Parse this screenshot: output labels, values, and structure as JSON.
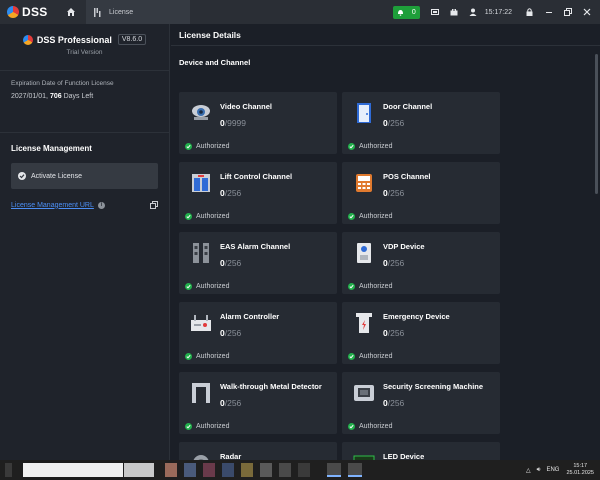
{
  "app": {
    "logo_text": "DSS",
    "tab_label": "License"
  },
  "topbar": {
    "notification_count": "0",
    "clock": "15:17:22"
  },
  "sidebar": {
    "product_name": "DSS Professional",
    "version": "V8.6.0",
    "edition": "Trial Version",
    "expiry_label": "Expiration Date of Function License",
    "expiry_date": "2027/01/01,",
    "days_left_number": "706",
    "days_left_suffix": "Days Left",
    "license_management_title": "License Management",
    "activate_label": "Activate License",
    "url_label": "License Management URL"
  },
  "main": {
    "header": "License Details",
    "section_title": "Device and Channel",
    "cards": [
      {
        "name": "Video Channel",
        "used": "0",
        "total": "/9999",
        "status": "Authorized",
        "icon": "camera-icon"
      },
      {
        "name": "Door Channel",
        "used": "0",
        "total": "/256",
        "status": "Authorized",
        "icon": "door-icon"
      },
      {
        "name": "Lift Control Channel",
        "used": "0",
        "total": "/256",
        "status": "Authorized",
        "icon": "elevator-icon"
      },
      {
        "name": "POS Channel",
        "used": "0",
        "total": "/256",
        "status": "Authorized",
        "icon": "pos-terminal-icon"
      },
      {
        "name": "EAS Alarm Channel",
        "used": "0",
        "total": "/256",
        "status": "Authorized",
        "icon": "eas-gate-icon"
      },
      {
        "name": "VDP Device",
        "used": "0",
        "total": "/256",
        "status": "Authorized",
        "icon": "intercom-icon"
      },
      {
        "name": "Alarm Controller",
        "used": "0",
        "total": "/256",
        "status": "Authorized",
        "icon": "alarm-controller-icon"
      },
      {
        "name": "Emergency Device",
        "used": "0",
        "total": "/256",
        "status": "Authorized",
        "icon": "emergency-device-icon"
      },
      {
        "name": "Walk-through Metal Detector",
        "used": "0",
        "total": "/256",
        "status": "Authorized",
        "icon": "metal-detector-icon"
      },
      {
        "name": "Security Screening Machine",
        "used": "0",
        "total": "/256",
        "status": "Authorized",
        "icon": "xray-machine-icon"
      },
      {
        "name": "Radar",
        "used": "",
        "total": "",
        "status": "",
        "icon": "radar-icon"
      },
      {
        "name": "LED Device",
        "used": "",
        "total": "",
        "status": "",
        "icon": "led-display-icon"
      }
    ]
  },
  "taskbar": {
    "language": "ENG",
    "time": "15:17",
    "date": "25.01.2025"
  },
  "colors": {
    "accent_green": "#22b14c",
    "link_blue": "#4c8ff5",
    "notification_green": "#1e9e3a"
  }
}
